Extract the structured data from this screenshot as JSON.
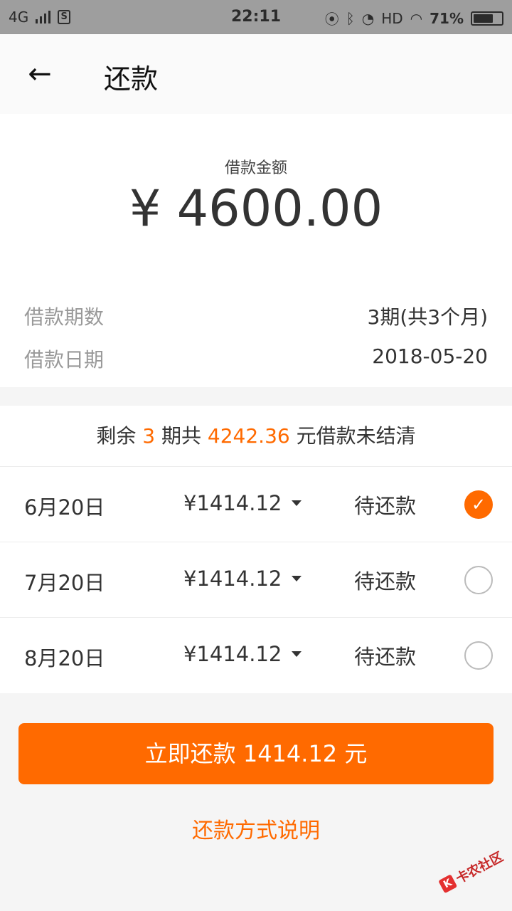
{
  "status_bar": {
    "network": "4G",
    "sim_icon_text": "S",
    "time": "22:11",
    "hd": "HD",
    "battery": "71%",
    "battery_level": 0.71,
    "icons": [
      "signal-icon",
      "sim-icon",
      "nfc-icon",
      "bluetooth-icon",
      "alarm-icon",
      "wifi-icon",
      "battery-icon"
    ]
  },
  "toolbar": {
    "back_icon": "arrow-left-icon",
    "title": "还款"
  },
  "loan": {
    "amount_label": "借款金额",
    "amount": "¥ 4600.00",
    "term_label": "借款期数",
    "term_value": "3期(共3个月)",
    "date_label": "借款日期",
    "date_value": "2018-05-20"
  },
  "remaining": {
    "prefix": "剩余 ",
    "periods": "3",
    "middle": " 期共 ",
    "amount": "4242.36",
    "suffix": " 元借款未结清"
  },
  "installments": [
    {
      "date": "6月20日",
      "amount": "¥1414.12",
      "status": "待还款",
      "checked": true,
      "check_icon": "checkmark-icon"
    },
    {
      "date": "7月20日",
      "amount": "¥1414.12",
      "status": "待还款",
      "checked": false
    },
    {
      "date": "8月20日",
      "amount": "¥1414.12",
      "status": "待还款",
      "checked": false
    }
  ],
  "pay_button": "立即还款 1414.12 元",
  "help_link": "还款方式说明",
  "watermark": {
    "icon_text": "K",
    "text": "卡农社区"
  },
  "colors": {
    "accent": "#ff6a00",
    "status_bar": "#9e9e9e"
  }
}
